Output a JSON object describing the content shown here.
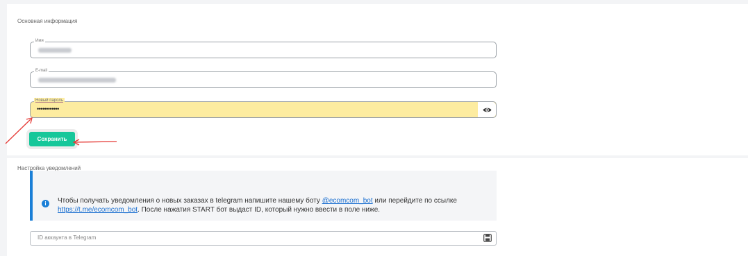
{
  "main_section": {
    "title": "Основная информация",
    "fields": {
      "name_label": "Имя",
      "email_label": "E-mail",
      "password_label": "Новый пароль",
      "password_mask": "••••••••••••"
    },
    "save_label": "Сохранить"
  },
  "notifications_section": {
    "title": "Настройка уведомлений",
    "notice": {
      "text_before_bot": "Чтобы получать уведомления о новых заказах в telegram напишите нашему боту ",
      "bot_link": "@ecomcom_bot",
      "text_middle": " или перейдите по ссылке ",
      "url_link": "https://t.me/ecomcom_bot",
      "text_after": ". После нажатия START бот выдаст ID, который нужно ввести в поле ниже."
    },
    "telegram_id_placeholder": "ID аккаунта в Telegram"
  },
  "icons": {
    "eye": "eye-icon",
    "info": "info-icon",
    "save": "floppy-disk-icon"
  },
  "colors": {
    "primary_button": "#16c79a",
    "password_autofill": "#fdeca0",
    "notice_accent": "#1a7fd7",
    "annotation_arrow": "#e53935"
  }
}
